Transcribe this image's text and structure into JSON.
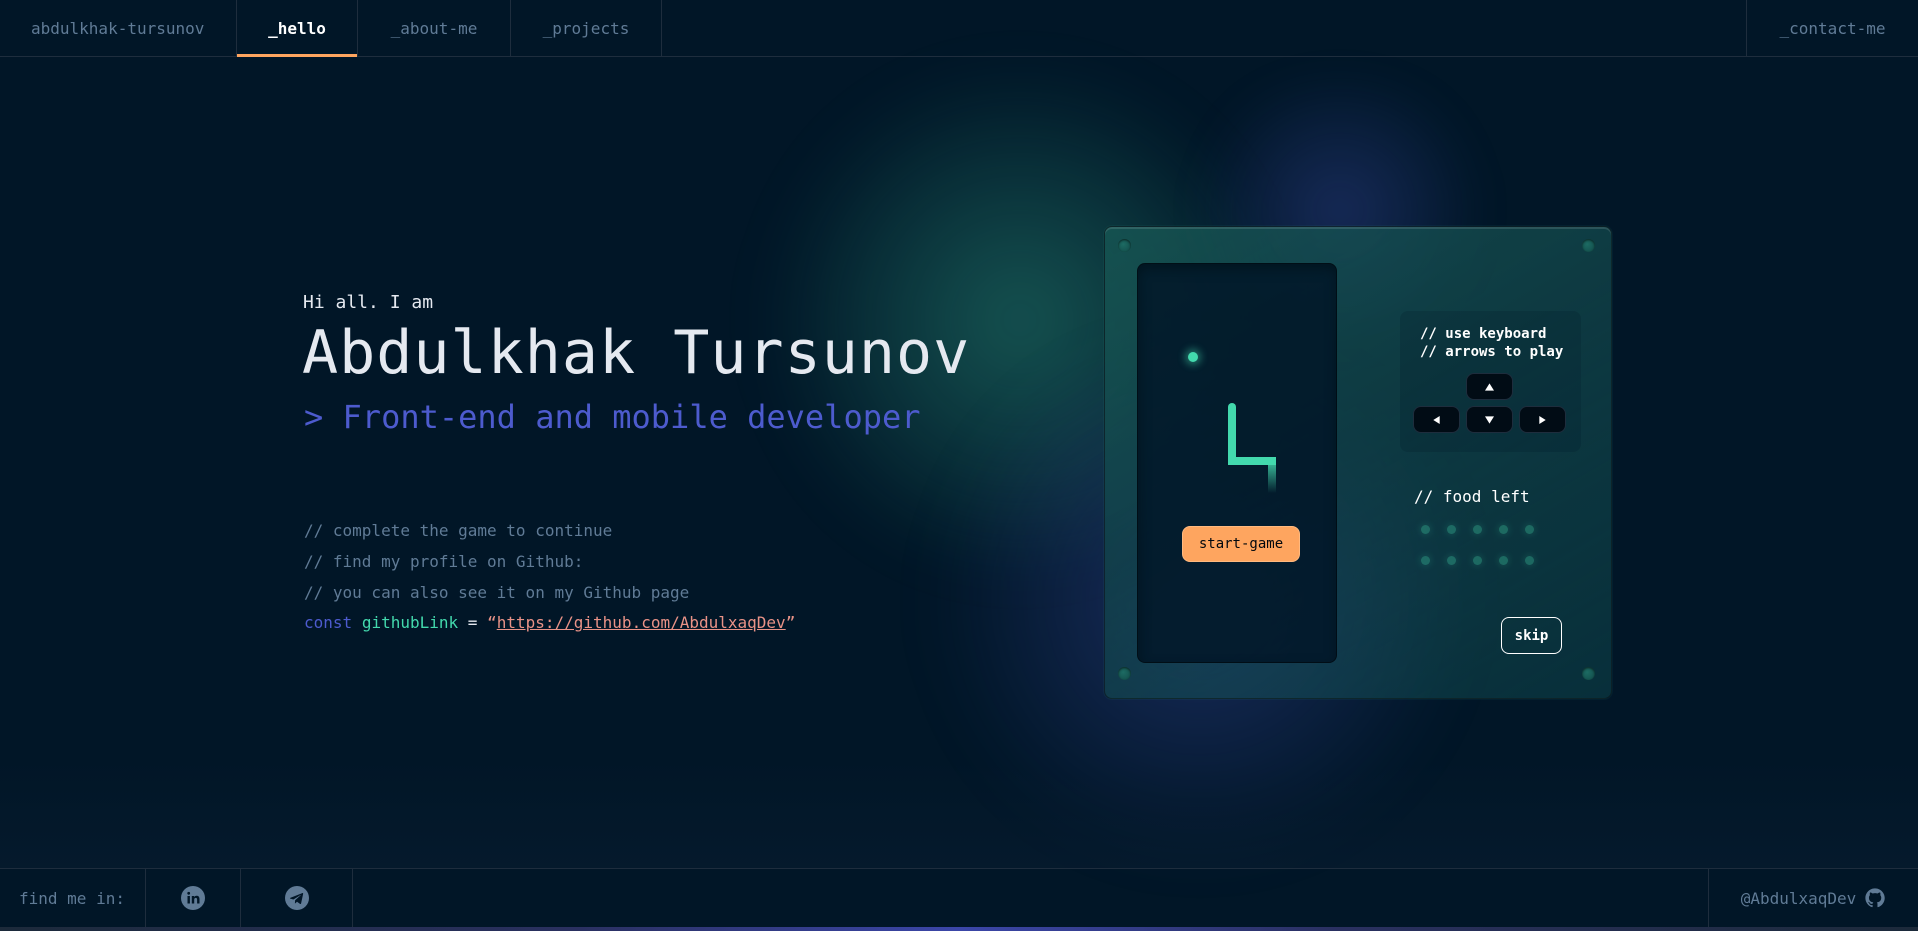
{
  "header": {
    "brand": "abdulkhak-tursunov",
    "tabs": [
      {
        "label": "_hello",
        "active": true
      },
      {
        "label": "_about-me",
        "active": false
      },
      {
        "label": "_projects",
        "active": false
      }
    ],
    "contact": "_contact-me"
  },
  "hero": {
    "greeting": "Hi all. I am",
    "name": "Abdulkhak Tursunov",
    "role": "> Front-end and mobile developer",
    "comments": [
      "// complete the game to continue",
      "// find my profile on Github:",
      "// you can also see it on my Github page"
    ],
    "code": {
      "keyword": "const",
      "variable": "githubLink",
      "operator": "=",
      "quote_open": "“",
      "link": "https://github.com/AbdulxaqDev",
      "quote_close": "”"
    }
  },
  "game": {
    "start_label": "start-game",
    "instructions": [
      "// use keyboard",
      "// arrows to play"
    ],
    "keys": [
      "arrow-up",
      "arrow-left",
      "arrow-down",
      "arrow-right"
    ],
    "food_left_label": "// food left",
    "food_left_count": 10,
    "skip_label": "skip"
  },
  "footer": {
    "find_me": "find me in:",
    "socials": [
      "linkedin-icon",
      "telegram-icon"
    ],
    "handle": "@AbdulxaqDev",
    "handle_icon": "github-icon"
  },
  "colors": {
    "background": "#011627",
    "accent_orange": "#FEA55F",
    "accent_green": "#43D9AD",
    "accent_blue": "#4D5BCE",
    "muted": "#607B96",
    "string": "#E99287"
  }
}
